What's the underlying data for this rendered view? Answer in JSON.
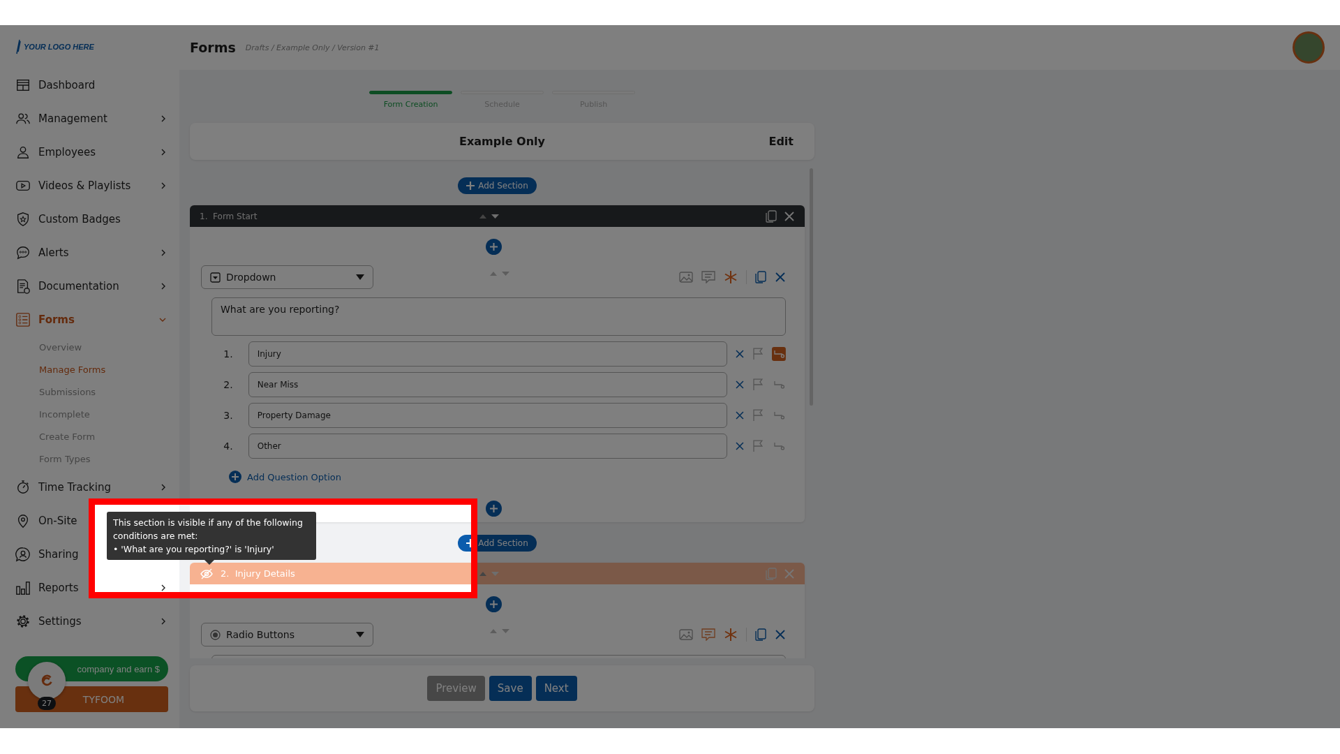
{
  "logo": {
    "text": "YOUR LOGO HERE"
  },
  "sidebar": {
    "items": [
      {
        "label": "Dashboard",
        "kind": "link",
        "selected": false
      },
      {
        "label": "Management",
        "kind": "group",
        "expanded": false,
        "selected": false
      },
      {
        "label": "Employees",
        "kind": "group",
        "expanded": false,
        "selected": false
      },
      {
        "label": "Videos & Playlists",
        "kind": "group",
        "expanded": false,
        "selected": false
      },
      {
        "label": "Custom Badges",
        "kind": "link",
        "selected": false
      },
      {
        "label": "Alerts",
        "kind": "group",
        "expanded": false,
        "selected": false
      },
      {
        "label": "Documentation",
        "kind": "group",
        "expanded": false,
        "selected": false
      },
      {
        "label": "Forms",
        "kind": "group",
        "expanded": true,
        "selected": true,
        "children": [
          {
            "label": "Overview",
            "selected": false
          },
          {
            "label": "Manage Forms",
            "selected": true
          },
          {
            "label": "Submissions",
            "selected": false
          },
          {
            "label": "Incomplete",
            "selected": false
          },
          {
            "label": "Create Form",
            "selected": false
          },
          {
            "label": "Form Types",
            "selected": false
          }
        ]
      },
      {
        "label": "Time Tracking",
        "kind": "group",
        "expanded": false,
        "selected": false
      },
      {
        "label": "On-Site",
        "kind": "link",
        "selected": false
      },
      {
        "label": "Sharing",
        "kind": "link",
        "selected": false
      },
      {
        "label": "Reports",
        "kind": "group",
        "expanded": false,
        "selected": false
      },
      {
        "label": "Settings",
        "kind": "group",
        "expanded": false,
        "selected": false
      }
    ]
  },
  "referral_button": {
    "label": "company and earn $"
  },
  "brand_button": {
    "label": "TYFOOM"
  },
  "chat": {
    "badge": "27"
  },
  "header": {
    "title": "Forms",
    "breadcrumb": "Drafts / Example Only / Version #1"
  },
  "steps": [
    {
      "label": "Form Creation",
      "selected": true
    },
    {
      "label": "Schedule",
      "selected": false
    },
    {
      "label": "Publish",
      "selected": false
    }
  ],
  "form_title": {
    "title": "Example Only",
    "edit": "Edit"
  },
  "sections": [
    {
      "add_section_label": "Add Section",
      "number": "1.",
      "title": "Form Start",
      "conditional": false,
      "questions": [
        {
          "kind": "dropdown",
          "type": "Dropdown",
          "prompt": "What are you reporting?",
          "required": true,
          "comment": false,
          "add_option": "Add Question Option",
          "options": [
            {
              "number": "1.",
              "label": "Injury",
              "logic": true
            },
            {
              "number": "2.",
              "label": "Near Miss",
              "logic": false
            },
            {
              "number": "3.",
              "label": "Property Damage",
              "logic": false
            },
            {
              "number": "4.",
              "label": "Other",
              "logic": false
            }
          ]
        }
      ]
    },
    {
      "add_section_label": "Add Section",
      "number": "2.",
      "title": "Injury Details",
      "conditional": true,
      "questions": [
        {
          "kind": "radio",
          "type": "Radio Buttons",
          "required": true,
          "comment": true
        }
      ]
    }
  ],
  "tooltip": {
    "text": "This section is visible if any of the following conditions are met:",
    "condition": "• 'What are you reporting?' is 'Injury'"
  },
  "footer_buttons": [
    {
      "label": "Preview",
      "disabled": true
    },
    {
      "label": "Save",
      "disabled": false
    },
    {
      "label": "Next",
      "disabled": false
    }
  ]
}
